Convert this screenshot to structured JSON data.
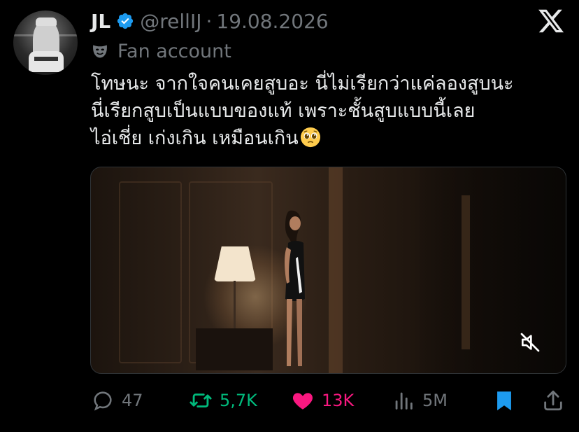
{
  "author": {
    "name": "JL",
    "handle": "@rellIJ",
    "separator": "·",
    "date": "19.08.2026",
    "verified": true,
    "label": "Fan account"
  },
  "tweet": {
    "text": "โทษนะ จากใจคนเคยสูบอะ นี่ไม่เรียกว่าแค่ลองสูบนะ\nนี่เรียกสูบเป็นแบบของแท้ เพราะชั้นสูบแบบนี้เลย\nไอ่เชี่ย เก่งเกิน เหมือนเกิน",
    "emoji": "pleading-face"
  },
  "media": {
    "type": "video",
    "muted": true
  },
  "actions": {
    "replies": "47",
    "reposts": "5,7K",
    "likes": "13K",
    "views": "5M",
    "bookmarked": true,
    "liked": true
  },
  "colors": {
    "background": "#000000",
    "text": "#e7e9ea",
    "muted": "#71767b",
    "verified": "#1d9bf0",
    "repost": "#00ba7c",
    "like": "#f91880",
    "bookmark": "#1d9bf0"
  },
  "icons": [
    "verified-badge-icon",
    "x-logo-icon",
    "mask-icon",
    "mute-icon",
    "reply-icon",
    "repost-icon",
    "heart-icon",
    "views-icon",
    "bookmark-icon",
    "share-icon"
  ]
}
